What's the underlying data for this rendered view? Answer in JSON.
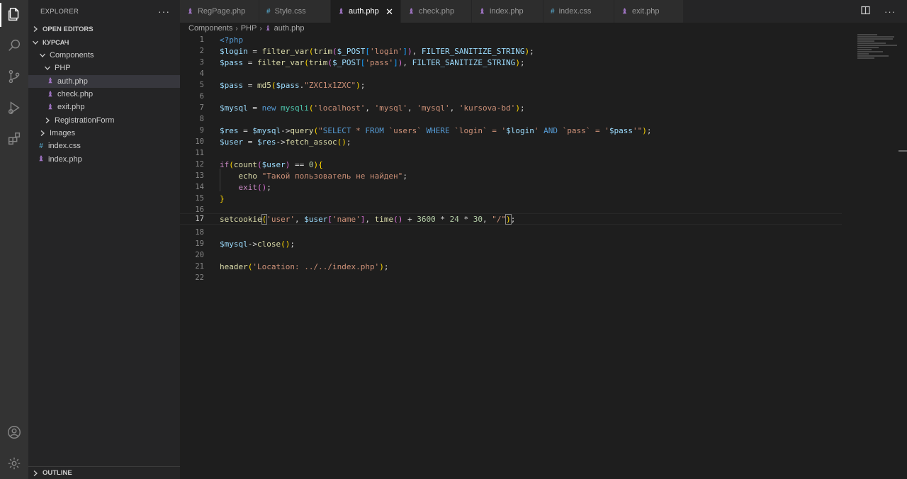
{
  "sidebar": {
    "title": "EXPLORER",
    "more": "···",
    "open_editors": "OPEN EDITORS",
    "workspace": "КУРСАЧ",
    "tree": [
      {
        "label": "Components",
        "type": "folder",
        "open": true
      },
      {
        "label": "PHP",
        "type": "folder",
        "open": true
      },
      {
        "label": "auth.php",
        "type": "php",
        "selected": true
      },
      {
        "label": "check.php",
        "type": "php"
      },
      {
        "label": "exit.php",
        "type": "php"
      },
      {
        "label": "RegistrationForm",
        "type": "folder",
        "open": false
      },
      {
        "label": "Images",
        "type": "folder",
        "open": false
      },
      {
        "label": "index.css",
        "type": "css"
      },
      {
        "label": "index.php",
        "type": "php"
      }
    ],
    "outline": "OUTLINE"
  },
  "tabs": [
    {
      "label": "RegPage.php",
      "icon": "php-icon"
    },
    {
      "label": "Style.css",
      "icon": "css-icon"
    },
    {
      "label": "auth.php",
      "icon": "php-icon",
      "active": true
    },
    {
      "label": "check.php",
      "icon": "php-icon"
    },
    {
      "label": "index.php",
      "icon": "php-icon"
    },
    {
      "label": "index.css",
      "icon": "css-icon"
    },
    {
      "label": "exit.php",
      "icon": "php-icon"
    }
  ],
  "tab_close": "✕",
  "breadcrumb": [
    "Components",
    "PHP",
    "auth.php"
  ],
  "editor": {
    "line_numbers": [
      "1",
      "2",
      "3",
      "4",
      "5",
      "6",
      "7",
      "8",
      "9",
      "10",
      "11",
      "12",
      "13",
      "14",
      "15",
      "16",
      "17",
      "18",
      "19",
      "20",
      "21",
      "22"
    ],
    "current_line": 17
  },
  "colors": {
    "accent": "#007acc",
    "php": "#a074c4",
    "css": "#519aba"
  }
}
